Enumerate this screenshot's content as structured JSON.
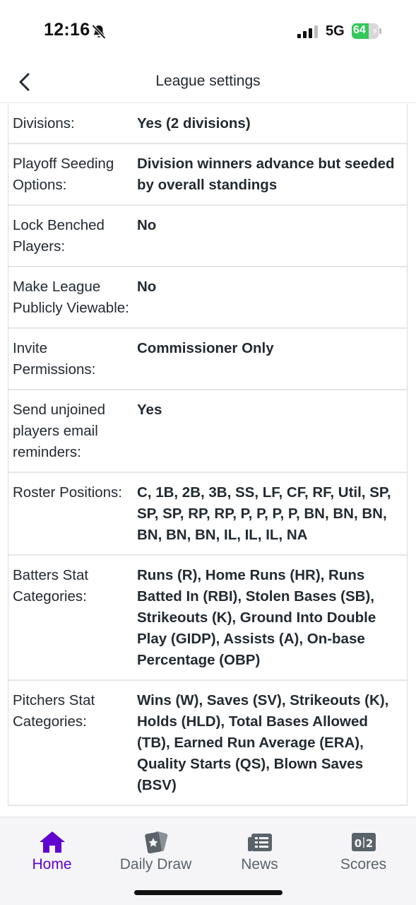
{
  "status_bar": {
    "time": "12:16",
    "network": "5G",
    "battery_level": "64",
    "battery_fraction": 0.64,
    "icons": [
      "bell-slash-icon",
      "signal-icon",
      "battery-charging-icon"
    ]
  },
  "header": {
    "title": "League settings",
    "back_icon": "chevron-left-icon"
  },
  "settings": {
    "rows": [
      {
        "label": "Divisions:",
        "value": "Yes (2 divisions)"
      },
      {
        "label": "Playoff Seeding Options:",
        "value": "Division winners advance but seeded by overall standings"
      },
      {
        "label": "Lock Benched Players:",
        "value": "No"
      },
      {
        "label": "Make League Publicly Viewable:",
        "value": "No"
      },
      {
        "label": "Invite Permissions:",
        "value": "Commissioner Only"
      },
      {
        "label": "Send unjoined players email reminders:",
        "value": "Yes"
      },
      {
        "label": "Roster Positions:",
        "value": "C, 1B, 2B, 3B, SS, LF, CF, RF, Util, SP, SP, SP, RP, RP, P, P, P, P, BN, BN, BN, BN, BN, BN, IL, IL, IL, NA"
      },
      {
        "label": "Batters Stat Categories:",
        "value": "Runs (R), Home Runs (HR), Runs Batted In (RBI), Stolen Bases (SB), Strikeouts (K), Ground Into Double Play (GIDP), Assists (A), On-base Percentage (OBP)"
      },
      {
        "label": "Pitchers Stat Categories:",
        "value": "Wins (W), Saves (SV), Strikeouts (K), Holds (HLD), Total Bases Allowed (TB), Earned Run Average (ERA), Quality Starts (QS), Blown Saves (BSV)"
      }
    ]
  },
  "tab_bar": {
    "accent_color": "#6001d2",
    "inactive_color": "#5b636a",
    "tabs": [
      {
        "label": "Home",
        "icon": "home-icon",
        "active": true
      },
      {
        "label": "Daily Draw",
        "icon": "cards-icon",
        "active": false
      },
      {
        "label": "News",
        "icon": "newspaper-icon",
        "active": false
      },
      {
        "label": "Scores",
        "icon": "scoreboard-icon",
        "active": false
      }
    ]
  }
}
